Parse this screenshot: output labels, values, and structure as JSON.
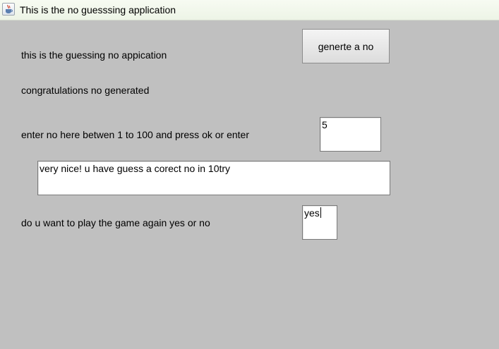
{
  "window": {
    "title": "This is the no guesssing application",
    "icon": "java-cup-icon"
  },
  "header": {
    "intro_label": "this is the guessing no appication",
    "generate_button_label": "generte a no"
  },
  "status": {
    "message": "congratulations no generated"
  },
  "guess": {
    "prompt_label": "enter no here betwen 1 to 100 and press ok or enter",
    "input_value": "5"
  },
  "result": {
    "message": "very nice!  u have guess a corect no in 10try"
  },
  "replay": {
    "prompt_label": "do u want to play the game again yes or no",
    "input_value": "yes"
  }
}
